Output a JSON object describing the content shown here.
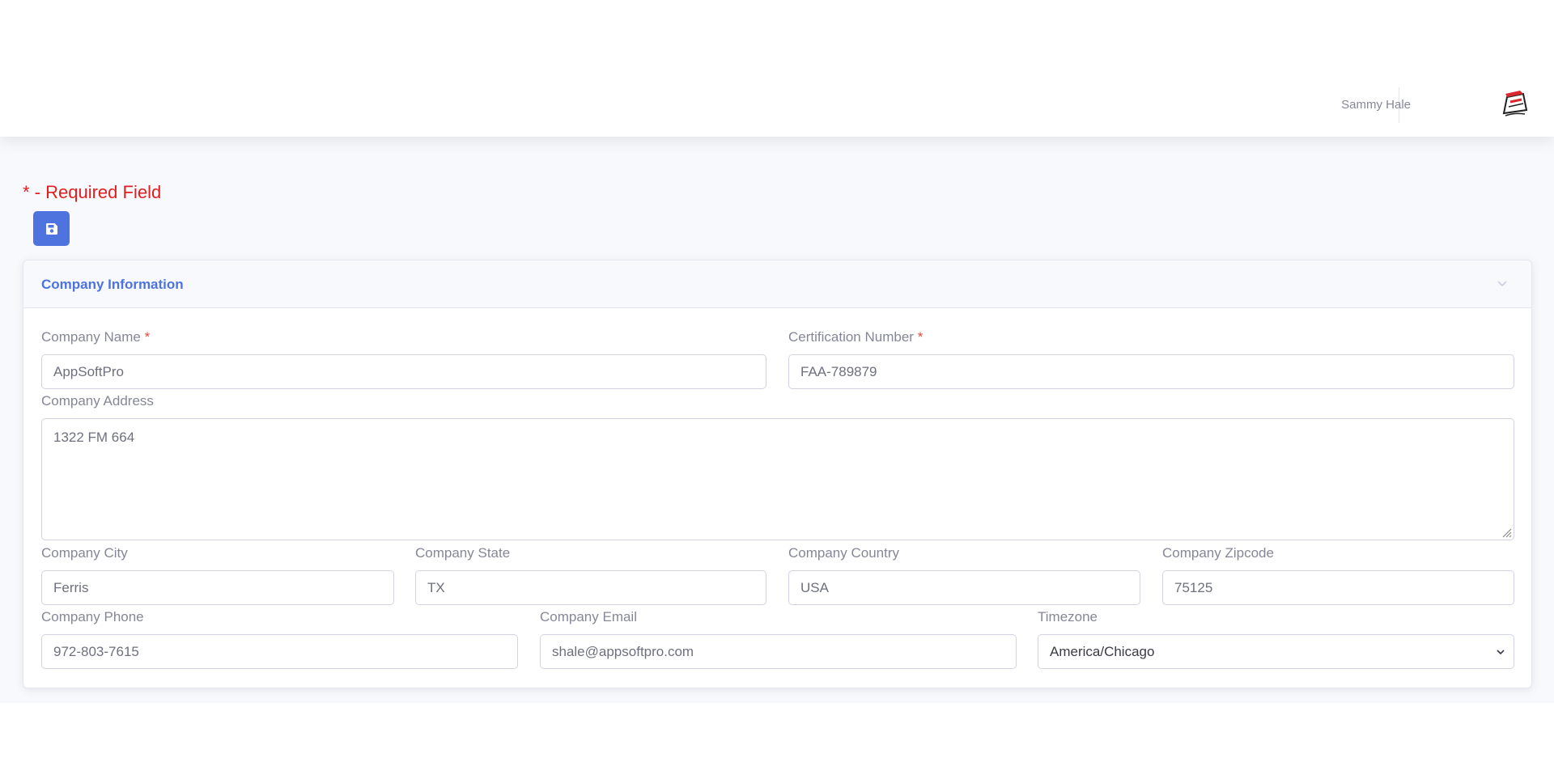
{
  "header": {
    "user_name": "Sammy Hale"
  },
  "form": {
    "required_note": "* - Required Field",
    "save_icon": "floppy-disk-icon",
    "card_title": "Company Information",
    "collapse_icon": "chevron-down-icon",
    "required_marker": "*",
    "fields": {
      "company_name": {
        "label": "Company Name",
        "value": "AppSoftPro"
      },
      "certification_number": {
        "label": "Certification Number",
        "value": "FAA-789879"
      },
      "company_address": {
        "label": "Company Address",
        "value": "1322 FM 664"
      },
      "company_city": {
        "label": "Company City",
        "value": "Ferris"
      },
      "company_state": {
        "label": "Company State",
        "value": "TX"
      },
      "company_country": {
        "label": "Company Country",
        "value": "USA"
      },
      "company_zipcode": {
        "label": "Company Zipcode",
        "value": "75125"
      },
      "company_phone": {
        "label": "Company Phone",
        "value": "972-803-7615"
      },
      "company_email": {
        "label": "Company Email",
        "value": "shale@appsoftpro.com"
      },
      "timezone": {
        "label": "Timezone",
        "value": "America/Chicago"
      }
    }
  },
  "colors": {
    "primary": "#4e73df",
    "required": "#e02020",
    "page_bg": "#f8f9fc"
  }
}
